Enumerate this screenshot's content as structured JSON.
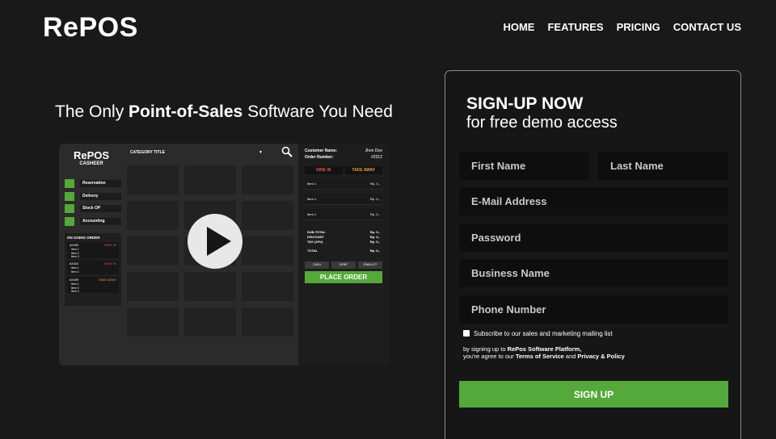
{
  "brand": "RePOS",
  "nav": [
    "HOME",
    "FEATURES",
    "PRICING",
    "CONTACT US"
  ],
  "hero": {
    "pre": "The Only ",
    "bold": "Point-of-Sales",
    "post": " Software You Need"
  },
  "mockup": {
    "brand": "RePOS",
    "brand_sub": "CASHEER",
    "menu": [
      "Reservation",
      "Delivery",
      "Stock OP",
      "Accounting"
    ],
    "orders_title": "ON GOING ORDER",
    "orders": [
      {
        "id": "#2453",
        "type": "DINE IN",
        "items": [
          "Item 1",
          "Item 2",
          "Item 3"
        ]
      },
      {
        "id": "#2424",
        "type": "DINE IN",
        "items": [
          "Item 1",
          "Item 2"
        ]
      },
      {
        "id": "#2409",
        "type": "TAKE AWAY",
        "items": [
          "Item 1",
          "Item 2",
          "Item 3"
        ]
      }
    ],
    "category_title": "CATEGORY TITLE",
    "customer_label": "Customer Name:",
    "customer_value": "Jhon Doe",
    "order_label": "Order Number:",
    "order_value": "#2312",
    "tabs": [
      "DINE IN",
      "TAKE AWAY"
    ],
    "lines": [
      {
        "name": "Item 1",
        "price": "Rp. 0,-"
      },
      {
        "name": "Item 1",
        "price": "Rp. 0,-"
      },
      {
        "name": "Item 1",
        "price": "Rp. 0,-"
      }
    ],
    "summary": [
      {
        "label": "SUB-TOTAL",
        "value": "Rp. 0,-"
      },
      {
        "label": "DISCOUNT",
        "value": "Rp. 0,-"
      },
      {
        "label": "TAX  (10%)",
        "value": "Rp. 0,-"
      }
    ],
    "total_label": "TOTAL",
    "total_value": "Rp. 0,-",
    "payments": [
      "CASH",
      "DEBIT",
      "EWALLET"
    ],
    "place_order": "PLACE ORDER"
  },
  "form": {
    "title": "SIGN-UP NOW",
    "subtitle": "for free demo access",
    "first_name": "First Name",
    "last_name": "Last Name",
    "email": "E-Mail Address",
    "password": "Password",
    "business": "Business Name",
    "phone": "Phone Number",
    "mailing": "Subscribe to our sales and marketing mailing list",
    "terms_1": "by signing up to ",
    "terms_platform": "RePos Software Platform,",
    "terms_2": "you're agree to our ",
    "terms_tos": "Terms of Service",
    "terms_and": " and ",
    "terms_privacy": "Privacy & Policy",
    "submit": "SIGN UP"
  },
  "colors": {
    "accent": "#55a83c",
    "tab_text": "#e05a4a",
    "take_away_text": "#e8a04a"
  }
}
